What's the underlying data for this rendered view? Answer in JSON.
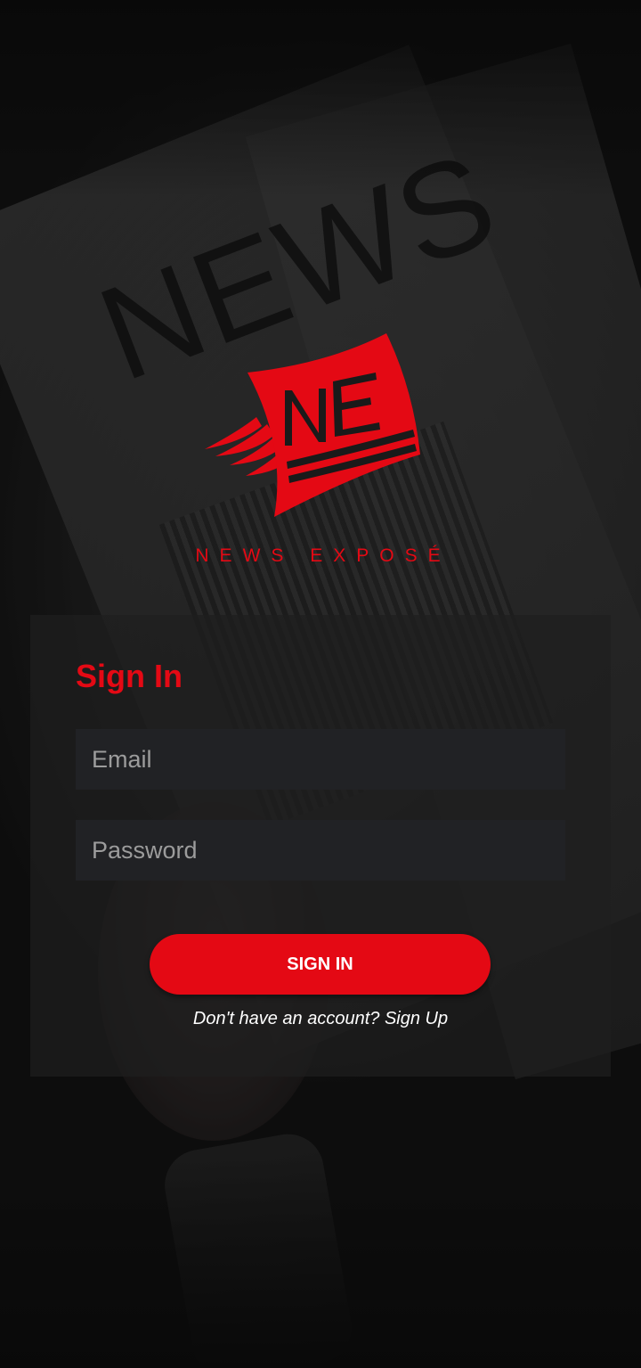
{
  "brand": {
    "logo_letters": "NE",
    "name": "NEWS EXPOSÉ",
    "accent_color": "#e40914"
  },
  "signin": {
    "title": "Sign In",
    "email_placeholder": "Email",
    "password_placeholder": "Password",
    "button_label": "SIGN IN",
    "signup_prompt": "Don't have an account? Sign Up"
  }
}
